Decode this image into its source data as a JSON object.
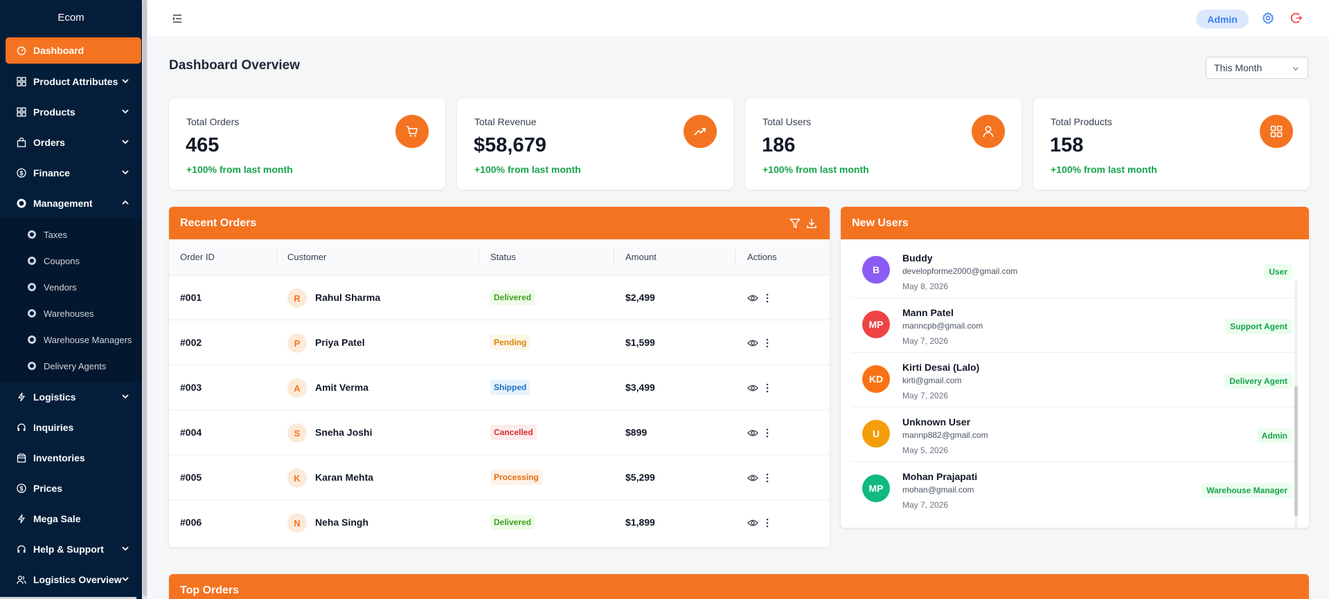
{
  "brand": "Ecom",
  "nav": {
    "dashboard": "Dashboard",
    "product_attributes": "Product Attributes",
    "products": "Products",
    "orders": "Orders",
    "finance": "Finance",
    "management": "Management",
    "management_sub": [
      "Taxes",
      "Coupons",
      "Vendors",
      "Warehouses",
      "Warehouse Managers",
      "Delivery Agents"
    ],
    "logistics": "Logistics",
    "inquiries": "Inquiries",
    "inventories": "Inventories",
    "prices": "Prices",
    "mega_sale": "Mega Sale",
    "help_support": "Help & Support",
    "logistics_overview": "Logistics Overview"
  },
  "topbar": {
    "role_badge": "Admin"
  },
  "page": {
    "title": "Dashboard Overview",
    "period": "This Month"
  },
  "stats": [
    {
      "label": "Total Orders",
      "value": "465",
      "change": "+100% from last month",
      "icon": "cart-icon"
    },
    {
      "label": "Total Revenue",
      "value": "$58,679",
      "change": "+100% from last month",
      "icon": "trending-up-icon"
    },
    {
      "label": "Total Users",
      "value": "186",
      "change": "+100% from last month",
      "icon": "user-icon"
    },
    {
      "label": "Total Products",
      "value": "158",
      "change": "+100% from last month",
      "icon": "grid-icon"
    }
  ],
  "recent_orders": {
    "title": "Recent Orders",
    "columns": [
      "Order ID",
      "Customer",
      "Status",
      "Amount",
      "Actions"
    ],
    "rows": [
      {
        "id": "#001",
        "initial": "R",
        "customer": "Rahul Sharma",
        "status": "Delivered",
        "amount": "$2,499"
      },
      {
        "id": "#002",
        "initial": "P",
        "customer": "Priya Patel",
        "status": "Pending",
        "amount": "$1,599"
      },
      {
        "id": "#003",
        "initial": "A",
        "customer": "Amit Verma",
        "status": "Shipped",
        "amount": "$3,499"
      },
      {
        "id": "#004",
        "initial": "S",
        "customer": "Sneha Joshi",
        "status": "Cancelled",
        "amount": "$899"
      },
      {
        "id": "#005",
        "initial": "K",
        "customer": "Karan Mehta",
        "status": "Processing",
        "amount": "$5,299"
      },
      {
        "id": "#006",
        "initial": "N",
        "customer": "Neha Singh",
        "status": "Delivered",
        "amount": "$1,899"
      }
    ]
  },
  "new_users": {
    "title": "New Users",
    "rows": [
      {
        "initials": "B",
        "name": "Buddy",
        "email": "developforme2000@gmail.com",
        "date": "May 8, 2026",
        "role": "User",
        "color": "#8b5cf6"
      },
      {
        "initials": "MP",
        "name": "Mann Patel",
        "email": "manncpb@gmail.com",
        "date": "May 7, 2026",
        "role": "Support Agent",
        "color": "#ef4444"
      },
      {
        "initials": "KD",
        "name": "Kirti Desai (Lalo)",
        "email": "kirti@gmail.com",
        "date": "May 7, 2026",
        "role": "Delivery Agent",
        "color": "#f97316"
      },
      {
        "initials": "U",
        "name": "Unknown User",
        "email": "mannp882@gmail.com",
        "date": "May 5, 2026",
        "role": "Admin",
        "color": "#f59e0b"
      },
      {
        "initials": "MP",
        "name": "Mohan Prajapati",
        "email": "mohan@gmail.com",
        "date": "May 7, 2026",
        "role": "Warehouse Manager",
        "color": "#10b981"
      }
    ]
  },
  "top_orders": {
    "title": "Top Orders"
  },
  "colors": {
    "accent": "#f47321",
    "sidebar": "#041e3a",
    "success": "#16a34a",
    "link": "#3b82f6"
  }
}
